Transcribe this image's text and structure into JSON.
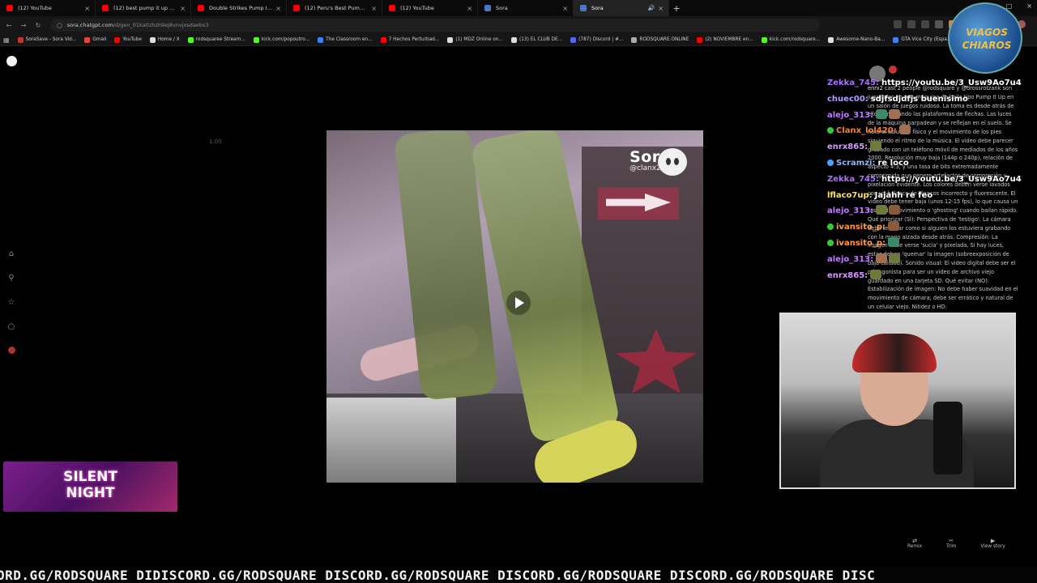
{
  "tabs": [
    {
      "title": "(12) YouTube",
      "color": "#ff0000",
      "active": false
    },
    {
      "title": "(12) best pump it up player - Yo",
      "color": "#ff0000",
      "active": false
    },
    {
      "title": "Double Strikes Pump It Up XX",
      "color": "#ff0000",
      "active": false
    },
    {
      "title": "(12) Peru's Best Pump It Up Pla",
      "color": "#ff0000",
      "active": false
    },
    {
      "title": "(12) YouTube",
      "color": "#ff0000",
      "active": false
    },
    {
      "title": "Sora",
      "color": "#4a78c8",
      "active": false
    },
    {
      "title": "Sora",
      "color": "#4a78c8",
      "active": true
    }
  ],
  "address": {
    "host": "sora.chatgpt.com",
    "path": "/d/gen_01ka0zhzh9ej8vnvjxsdaebs3"
  },
  "bookmarks": [
    {
      "label": "SoraSave - Sora Vid...",
      "color": "#c0392b"
    },
    {
      "label": "Gmail",
      "color": "#ea4335"
    },
    {
      "label": "YouTube",
      "color": "#ff0000"
    },
    {
      "label": "Home / X",
      "color": "#dddddd"
    },
    {
      "label": "rodsquaree Stream...",
      "color": "#53fc18"
    },
    {
      "label": "kick.com/popoutro...",
      "color": "#53fc18"
    },
    {
      "label": "The Classroom en...",
      "color": "#3b82f6"
    },
    {
      "label": "7 Hechos Perturbad...",
      "color": "#ff0000"
    },
    {
      "label": "(1) MDZ Online on...",
      "color": "#dddddd"
    },
    {
      "label": "(13) EL CLUB DE...",
      "color": "#dddddd"
    },
    {
      "label": "(787) Discord | #...",
      "color": "#5865f2"
    },
    {
      "label": "RODSQUARE.ONLINE",
      "color": "#aaaaaa"
    },
    {
      "label": "(2) NOVIEMBRE en...",
      "color": "#ff0000"
    },
    {
      "label": "kick.com/rodsquare...",
      "color": "#53fc18"
    },
    {
      "label": "Awesome-Nano-Ba...",
      "color": "#dddddd"
    },
    {
      "label": "GTA Vice City (Espa...",
      "color": "#3b82f6"
    }
  ],
  "player": {
    "speed": "1.00",
    "watermark_brand": "Sora",
    "watermark_user": "@clanx2"
  },
  "prompt": {
    "user": "enrx2",
    "cast": "cast 2 people",
    "text": "@rodsquare y @drossrotzank son jugadores en una máquina de baile tipo Pump It Up en un salón de juegos ruidoso. La toma es desde atrás de ellos, enfocando las plataformas de flechas. Las luces de la máquina parpadean y se reflejan en el suelo. Se nota el esfuerzo físico y el movimiento de los pies siguiendo el ritmo de la música. El video debe parecer grabado con un teléfono móvil de mediados de los años 2000. Resolución muy baja (144p o 240p), relación de aspecto 4:3, y una tasa de bits extremadamente comprimida que genere artefactos de compresión y pixelación evidente. Los colores deben verse lavados con un balance de blancos incorrecto y fluorescente. El video debe tener baja (unos 12-15 fps), lo que causa un rastro de movimiento o 'ghosting' cuando bailan rápido. Qué priorizar (SÍ): Perspectiva de 'testigo': La cámara debe temblar como si alguien los estuviera grabando con la mano alzada desde atrás. Compresión: La imagen debe verse 'sucia' y pixelada. Si hay luces, estas deben 'quemar' la imagen (sobreexposición de baja calidad). Sonido visual: El video digital debe ser el protagonista para ser un video de archivo viejo guardado en una tarjeta SD. Qué evitar (NO): Estabilización de imagen: No debe haber suavidad en el movimiento de cámara; debe ser errático y natural de un celular viejo. Nitidez o HD:"
  },
  "chat": [
    {
      "user": "Zekka_745:",
      "color": "#a970ff",
      "text": "https://youtu.be/3_Usw9Ao7u4",
      "emotes": 0
    },
    {
      "user": "chuec00:",
      "color": "#b49dff",
      "text": "sdjfsdjdfjs buenisimo",
      "emotes": 0
    },
    {
      "user": "alejo_313:",
      "color": "#c07aff",
      "text": "",
      "emotes": 2
    },
    {
      "user": "Clanx_lol420:",
      "color": "#ff7f24",
      "text": "",
      "emotes": 1
    },
    {
      "user": "enrx865:",
      "color": "#d896ff",
      "text": "",
      "emotes": 1
    },
    {
      "user": "Scramzi:",
      "color": "#8ab4ff",
      "text": "re loco",
      "emotes": 0
    },
    {
      "user": "Zekka_745:",
      "color": "#a970ff",
      "text": "https://youtu.be/3_Usw9Ao7u4",
      "emotes": 0
    },
    {
      "user": "lflaco7up:",
      "color": "#ffe24a",
      "text": "Jajahh re feo",
      "emotes": 0
    },
    {
      "user": "alejo_313:",
      "color": "#c07aff",
      "text": "",
      "emotes": 2
    },
    {
      "user": "ivansito_p:",
      "color": "#ff9a3c",
      "text": "",
      "emotes": 1
    },
    {
      "user": "ivansito_p:",
      "color": "#ff9a3c",
      "text": "",
      "emotes": 1
    },
    {
      "user": "alejo_313:",
      "color": "#c07aff",
      "text": "",
      "emotes": 2
    },
    {
      "user": "enrx865:",
      "color": "#d896ff",
      "text": "",
      "emotes": 1
    }
  ],
  "channel_logo": {
    "line1": "VIAGOS",
    "line2": "CHIAROS"
  },
  "actions": [
    {
      "label": "Remix",
      "icon": "remix-icon"
    },
    {
      "label": "Trim",
      "icon": "trim-icon"
    },
    {
      "label": "View story",
      "icon": "view-story-icon"
    }
  ],
  "banner": {
    "line1": "SILENT",
    "line2": "NIGHT"
  },
  "ticker": "ORD.GG/RODSQUARE DIDISCORD.GG/RODSQUARE DISCORD.GG/RODSQUARE DISCORD.GG/RODSQUARE DISCORD.GG/RODSQUARE DISC"
}
